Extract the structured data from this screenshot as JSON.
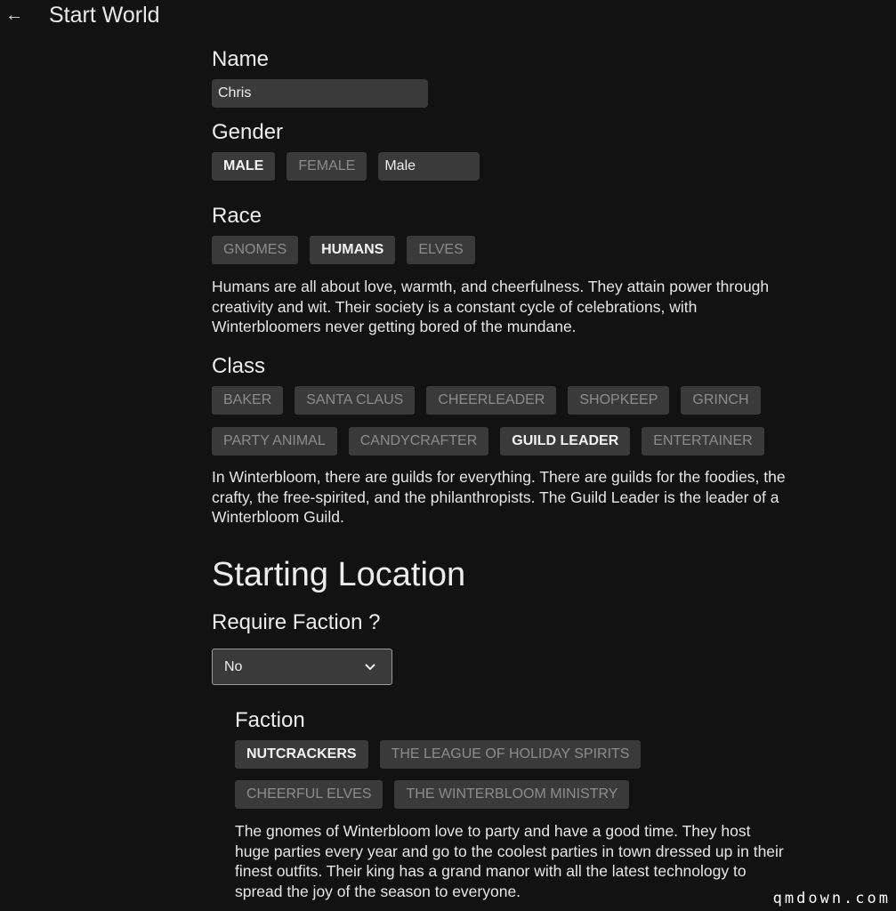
{
  "header": {
    "title": "Start World",
    "back_icon": "arrow-left-icon"
  },
  "name": {
    "label": "Name",
    "value": "Chris"
  },
  "gender": {
    "label": "Gender",
    "options": [
      "MALE",
      "FEMALE"
    ],
    "selected": "MALE",
    "custom_value": "Male"
  },
  "race": {
    "label": "Race",
    "options": [
      "GNOMES",
      "HUMANS",
      "ELVES"
    ],
    "selected": "HUMANS",
    "description": "Humans are all about love, warmth, and cheerfulness. They attain power through creativity and wit. Their society is a constant cycle of celebrations, with Winterbloomers never getting bored of the mundane."
  },
  "class": {
    "label": "Class",
    "row1": [
      "BAKER",
      "SANTA CLAUS",
      "CHEERLEADER",
      "SHOPKEEP",
      "GRINCH"
    ],
    "row2": [
      "PARTY ANIMAL",
      "CANDYCRAFTER",
      "GUILD LEADER",
      "ENTERTAINER"
    ],
    "selected": "GUILD LEADER",
    "description": "In Winterbloom, there are guilds for everything. There are guilds for the foodies, the crafty, the free-spirited, and the philanthropists. The Guild Leader is the leader of a Winterbloom Guild."
  },
  "starting_location": {
    "heading": "Starting Location",
    "require_faction_label": "Require Faction ?",
    "require_faction_value": "No"
  },
  "faction": {
    "label": "Faction",
    "row1": [
      "NUTCRACKERS",
      "THE LEAGUE OF HOLIDAY SPIRITS"
    ],
    "row2": [
      "CHEERFUL ELVES",
      "THE WINTERBLOOM MINISTRY"
    ],
    "selected": "NUTCRACKERS",
    "description": "The gnomes of Winterbloom love to party and have a good time. They host huge parties every year and go to the coolest parties in town dressed up in their finest outfits. Their king has a grand manor with all the latest technology to spread the joy of the season to everyone."
  },
  "watermark": "qmdown.com",
  "colors": {
    "background": "#121212",
    "chip": "#3a3a3a",
    "text": "#e6e6e6",
    "muted": "#8c8c8c"
  }
}
